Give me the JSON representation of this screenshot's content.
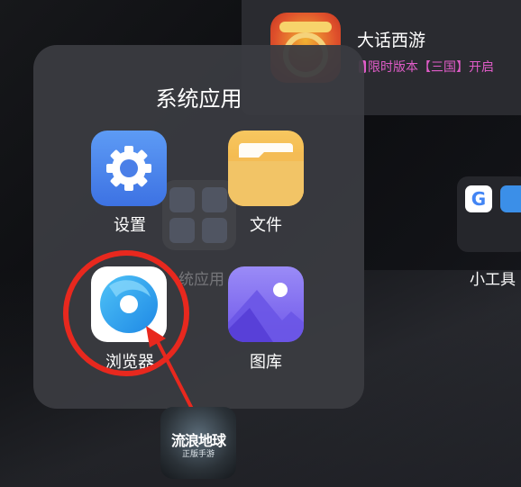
{
  "notification": {
    "title": "大话西游",
    "subtitle": "限时版本【三国】开启",
    "icon": "dahuaxiyou-game-icon"
  },
  "folder": {
    "title": "系统应用",
    "apps": [
      {
        "label": "设置",
        "icon": "gear-icon",
        "color": "#4a84ec"
      },
      {
        "label": "文件",
        "icon": "folder-icon",
        "color": "#f2b54a"
      },
      {
        "label": "浏览器",
        "icon": "browser-icon",
        "color": "#2f9be8"
      },
      {
        "label": "图库",
        "icon": "gallery-icon",
        "color": "#7b66ef"
      }
    ]
  },
  "background": {
    "ghost_folder_label": "统应用",
    "tools_widget_label": "小工具",
    "game": {
      "title": "流浪地球",
      "subtitle": "正版手游"
    }
  },
  "annotation": {
    "color": "#e8281e",
    "target": "browser"
  }
}
